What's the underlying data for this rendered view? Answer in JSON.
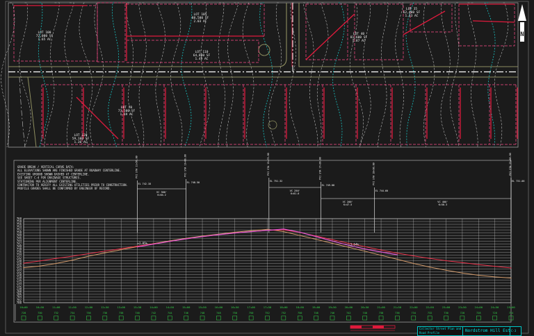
{
  "colors": {
    "background": "#1b1b1b",
    "contour": "#d9d9d9",
    "contour_index": "#19c6c6",
    "lot_line": "#ff4c8a",
    "building": "#e01a3c",
    "road": "#8e8e60",
    "centerline": "#ffffff",
    "profile_existing": "#d29a6a",
    "profile_design_a": "#e8314a",
    "profile_design_b": "#e25ad6",
    "grid": "#c8c8c8",
    "station_text": "#34d84a",
    "title_block": "#00c8c8"
  },
  "plan": {
    "north_arrow": {
      "icon": "north-arrow-icon",
      "letter": "N"
    },
    "lots": [
      {
        "name": "LOT 100",
        "line2": "72,000 SF",
        "line3": "1.65 AC"
      },
      {
        "name": "LOT 105",
        "line2": "88,500 SF",
        "line3": "2.03 AC"
      },
      {
        "name": "LOT 110",
        "line2": "64,800 SF",
        "line3": "1.49 AC"
      },
      {
        "name": "LOT 35",
        "line2": "62,400 SF",
        "line3": "1.43 AC"
      },
      {
        "name": "LOT 40",
        "line2": "81,600 SF",
        "line3": "1.87 AC"
      },
      {
        "name": "LOT 70",
        "line2": "73,500 SF",
        "line3": "1.69 AC"
      },
      {
        "name": "LOT 120",
        "line2": "59,100 SF",
        "line3": "1.36 AC"
      }
    ]
  },
  "profile": {
    "notes": [
      "GRADE BREAK / VERTICAL CURVE DATA:",
      "ALL ELEVATIONS SHOWN ARE FINISHED GRADE AT ROADWAY CENTERLINE.",
      "EXISTING GROUND SHOWN DASHED AT CENTERLINE.",
      "SEE SHEET C-4 FOR DRAINAGE STRUCTURES.",
      "STATIONING PER ALIGNMENT CENTERLINE.",
      "CONTRACTOR TO VERIFY ALL EXISTING UTILITIES PRIOR TO CONSTRUCTION.",
      "PROFILE GRADES SHALL BE CONFIRMED BY ENGINEER OF RECORD."
    ],
    "callouts": [
      {
        "label": "PVI STA 11+50.00",
        "sub": "EL 742.18"
      },
      {
        "label": "PVI STA 13+00.00",
        "sub": "EL 748.50"
      },
      {
        "label": "PVI STA 15+75.00",
        "sub": "EL 751.32"
      },
      {
        "label": "PVI STA 17+30.00",
        "sub": "EL 749.88"
      },
      {
        "label": "PVI STA 18+90.00",
        "sub": "EL 744.60"
      },
      {
        "label": "PVI STA 23+60.00",
        "sub": "EL 731.06"
      }
    ],
    "curve_labels": [
      {
        "text": "VC 300'",
        "sub": "K=64.2"
      },
      {
        "text": "VC 250'",
        "sub": "K=81.0"
      },
      {
        "text": "VC 200'",
        "sub": "K=47.5"
      },
      {
        "text": "VC 400'",
        "sub": "K=58.3"
      }
    ],
    "grade_labels": [
      "+2.85%",
      "-3.14%"
    ],
    "elevations": [
      "760",
      "758",
      "756",
      "754",
      "752",
      "750",
      "748",
      "746",
      "744",
      "742",
      "740",
      "738",
      "736",
      "734",
      "732",
      "730",
      "728",
      "726",
      "724",
      "722",
      "720",
      "718",
      "716",
      "714",
      "712",
      "710",
      "708",
      "706",
      "704",
      "702",
      "700"
    ],
    "stations": [
      "10+00",
      "10+50",
      "11+00",
      "11+50",
      "12+00",
      "12+50",
      "13+00",
      "13+50",
      "14+00",
      "14+50",
      "15+00",
      "15+50",
      "16+00",
      "16+50",
      "17+00",
      "17+50",
      "18+00",
      "18+50",
      "19+00",
      "19+50",
      "20+00",
      "20+50",
      "21+00",
      "21+50",
      "22+00",
      "22+50",
      "23+00",
      "23+50",
      "24+00",
      "24+50",
      "25+00"
    ]
  },
  "chart_data": {
    "type": "line",
    "title": "",
    "xlabel": "",
    "ylabel": "",
    "x": [
      0,
      1,
      2,
      3,
      4,
      5,
      6,
      7,
      8,
      9,
      10,
      11,
      12,
      13,
      14,
      15,
      16,
      17,
      18,
      19,
      20,
      21,
      22,
      23,
      24,
      25,
      26,
      27,
      28,
      29,
      30
    ],
    "xlim": [
      0,
      30
    ],
    "ylim": [
      0,
      30
    ],
    "series": [
      {
        "name": "",
        "style": "existing",
        "values": [
          12.5,
          13.1,
          14.0,
          15.2,
          16.6,
          17.8,
          18.9,
          20.0,
          21.1,
          22.1,
          23.0,
          23.8,
          24.5,
          25.2,
          25.7,
          26.2,
          25.4,
          24.0,
          22.6,
          21.2,
          19.8,
          18.4,
          16.9,
          15.5,
          14.0,
          12.7,
          11.6,
          10.6,
          9.8,
          9.2,
          8.8
        ]
      },
      {
        "name": "",
        "style": "design_a",
        "values": [
          14.1,
          14.9,
          15.8,
          16.6,
          17.5,
          18.4,
          19.3,
          20.2,
          21.0,
          21.9,
          22.8,
          23.6,
          24.3,
          24.9,
          25.4,
          25.8,
          26.0,
          25.1,
          23.8,
          22.5,
          21.2,
          20.0,
          18.8,
          17.7,
          16.7,
          15.8,
          15.0,
          14.3,
          13.6,
          13.0,
          12.4
        ]
      },
      {
        "name": "",
        "style": "design_b",
        "values": [
          null,
          null,
          null,
          null,
          null,
          null,
          null,
          19.9,
          20.9,
          21.9,
          22.8,
          23.6,
          24.3,
          24.9,
          25.4,
          25.8,
          26.3,
          25.2,
          23.6,
          22.0,
          20.5,
          19.2,
          18.1,
          17.1,
          null,
          null,
          null,
          null,
          null,
          null,
          null
        ]
      }
    ],
    "grid": true
  },
  "title_block": {
    "row1": "Collector Street Plan and Profile",
    "row2": "Road Profile",
    "project": "Nordstrom Hill Estates",
    "sheet": "C-3"
  }
}
